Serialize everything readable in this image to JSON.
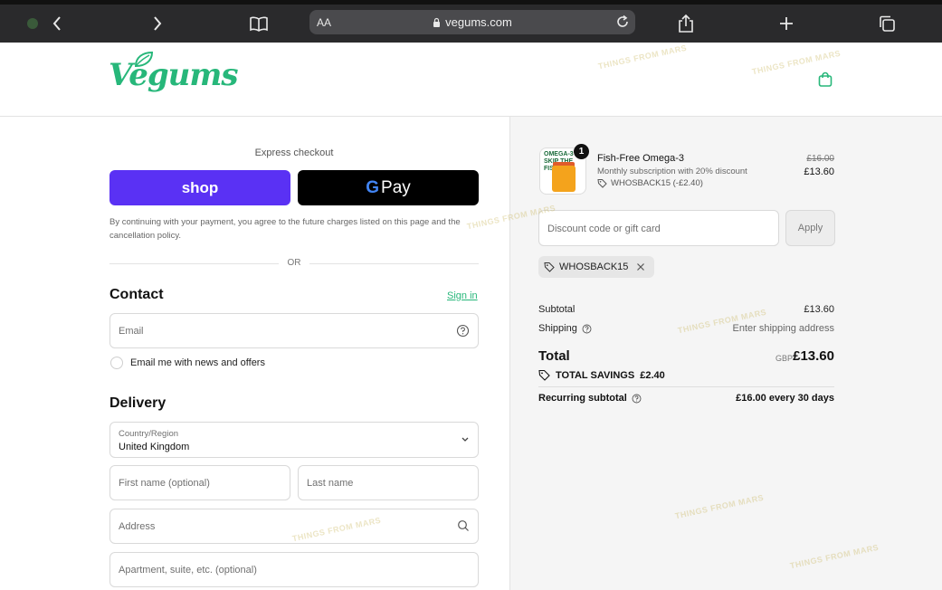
{
  "browser": {
    "aa_label": "AA",
    "url": "vegums.com"
  },
  "header": {
    "logo_text": "Vegums"
  },
  "express": {
    "title": "Express checkout",
    "shop_label": "shop",
    "gpay_g": "G",
    "gpay_label": "Pay",
    "consent": "By continuing with your payment, you agree to the future charges listed on this page and the cancellation policy.",
    "or_label": "OR"
  },
  "contact": {
    "title": "Contact",
    "signin_label": "Sign in",
    "email_placeholder": "Email",
    "news_label": "Email me with news and offers"
  },
  "delivery": {
    "title": "Delivery",
    "country_label": "Country/Region",
    "country_value": "United Kingdom",
    "first_name_placeholder": "First name (optional)",
    "last_name_placeholder": "Last name",
    "address_placeholder": "Address",
    "apartment_placeholder": "Apartment, suite, etc. (optional)"
  },
  "summary": {
    "product": {
      "thumb_text": "OMEGA-3 SKIP THE FISH",
      "quantity": "1",
      "name": "Fish-Free Omega-3",
      "subtitle": "Monthly subscription with 20% discount",
      "discount_line": "WHOSBACK15 (-£2.40)",
      "old_price": "£16.00",
      "new_price": "£13.60"
    },
    "discount_placeholder": "Discount code or gift card",
    "apply_label": "Apply",
    "applied_code": "WHOSBACK15",
    "subtotal_label": "Subtotal",
    "subtotal_value": "£13.60",
    "shipping_label": "Shipping",
    "shipping_value": "Enter shipping address",
    "total_label": "Total",
    "total_currency": "GBP",
    "total_value": "£13.60",
    "savings_label": "TOTAL SAVINGS",
    "savings_value": "£2.40",
    "recurring_label": "Recurring subtotal",
    "recurring_value": "£16.00 every 30 days"
  },
  "watermark": "THINGS FROM MARS",
  "colors": {
    "brand_green": "#27b77a",
    "shop_purple": "#5a31f4",
    "gpay_black": "#000000"
  }
}
